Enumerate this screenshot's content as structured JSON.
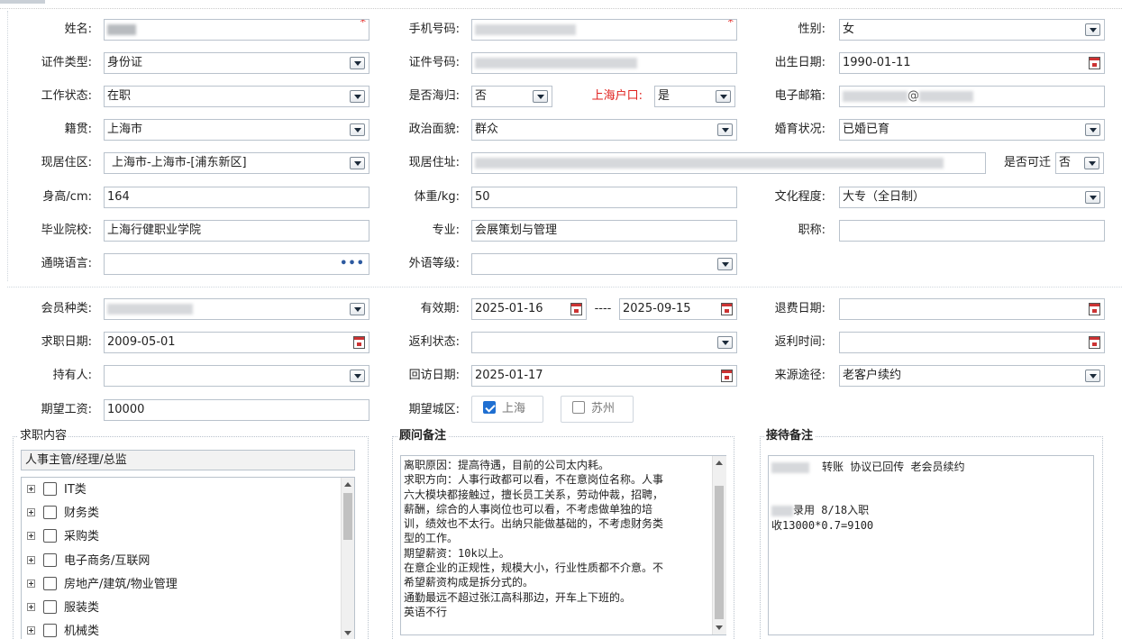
{
  "personal": {
    "name": {
      "label": "姓名:",
      "value": "",
      "required": "*"
    },
    "phone": {
      "label": "手机号码:",
      "value": "",
      "required": "*"
    },
    "gender": {
      "label": "性别:",
      "value": "女"
    },
    "id_type": {
      "label": "证件类型:",
      "value": "身份证"
    },
    "id_number": {
      "label": "证件号码:",
      "value": ""
    },
    "birth_date": {
      "label": "出生日期:",
      "value": "1990-01-11"
    },
    "work_status": {
      "label": "工作状态:",
      "value": "在职"
    },
    "returnee": {
      "label": "是否海归:",
      "value": "否"
    },
    "shanghai_hukou": {
      "label": "上海户口:",
      "value": "是"
    },
    "email": {
      "label": "电子邮箱:",
      "value": "@"
    },
    "native_place": {
      "label": "籍贯:",
      "value": "上海市"
    },
    "political_status": {
      "label": "政治面貌:",
      "value": "群众"
    },
    "marital_status": {
      "label": "婚育状况:",
      "value": "已婚已育"
    },
    "residence_area": {
      "label": "现居住区:",
      "value": "上海市-上海市-[浦东新区]"
    },
    "residence_address": {
      "label": "现居住址:",
      "value": ""
    },
    "relocatable": {
      "label": "是否可迁",
      "value": "否"
    },
    "height": {
      "label": "身高/cm:",
      "value": "164"
    },
    "weight": {
      "label": "体重/kg:",
      "value": "50"
    },
    "education": {
      "label": "文化程度:",
      "value": "大专（全日制）"
    },
    "school": {
      "label": "毕业院校:",
      "value": "上海行健职业学院"
    },
    "major": {
      "label": "专业:",
      "value": "会展策划与管理"
    },
    "title": {
      "label": "职称:",
      "value": ""
    },
    "languages": {
      "label": "通晓语言:",
      "value": "",
      "button": "•••"
    },
    "foreign_level": {
      "label": "外语等级:",
      "value": ""
    }
  },
  "membership": {
    "member_type": {
      "label": "会员种类:",
      "value": ""
    },
    "valid_period": {
      "label": "有效期:",
      "start": "2025-01-16",
      "separator": "----",
      "end": "2025-09-15"
    },
    "refund_date": {
      "label": "退费日期:",
      "value": ""
    },
    "job_search_date": {
      "label": "求职日期:",
      "value": "2009-05-01"
    },
    "rebate_status": {
      "label": "返利状态:",
      "value": ""
    },
    "rebate_time": {
      "label": "返利时间:",
      "value": ""
    },
    "holder": {
      "label": "持有人:",
      "value": ""
    },
    "visit_date": {
      "label": "回访日期:",
      "value": "2025-01-17"
    },
    "source": {
      "label": "来源途径:",
      "value": "老客户续约"
    },
    "expected_salary": {
      "label": "期望工资:",
      "value": "10000"
    },
    "expected_city": {
      "label": "期望城区:",
      "options": [
        {
          "label": "上海",
          "checked": true
        },
        {
          "label": "苏州",
          "checked": false
        }
      ]
    }
  },
  "job_content": {
    "legend": "求职内容",
    "selected": "人事主管/经理/总监",
    "tree": [
      "IT类",
      "财务类",
      "采购类",
      "电子商务/互联网",
      "房地产/建筑/物业管理",
      "服装类",
      "机械类"
    ]
  },
  "consultant_notes": {
    "legend": "顾问备注",
    "lines": [
      "离职原因：提高待遇，目前的公司太内耗。",
      "求职方向：人事行政都可以看，不在意岗位名称。人事",
      "六大模块都接触过，擅长员工关系，劳动仲裁，招聘，",
      "薪酬，综合的人事岗位也可以看，不考虑做单独的培",
      "训，绩效也不太行。出纳只能做基础的，不考虑财务类",
      "型的工作。",
      "期望薪资：10k以上。",
      "在意企业的正规性，规模大小，行业性质都不介意。不",
      "希望薪资构成是拆分式的。",
      "通勤最远不超过张江高科那边，开车上下班的。",
      "英语不行"
    ]
  },
  "reception_notes": {
    "legend": "接待备注",
    "lines": [
      "转账 协议已回传  老会员续约",
      "",
      "",
      "录用 8/18入职",
      "收13000*0.7=9100"
    ]
  },
  "colors": {
    "required": "#e0201d",
    "hukou_label": "#e0201d",
    "checkbox_on": "#1f6fd1"
  }
}
